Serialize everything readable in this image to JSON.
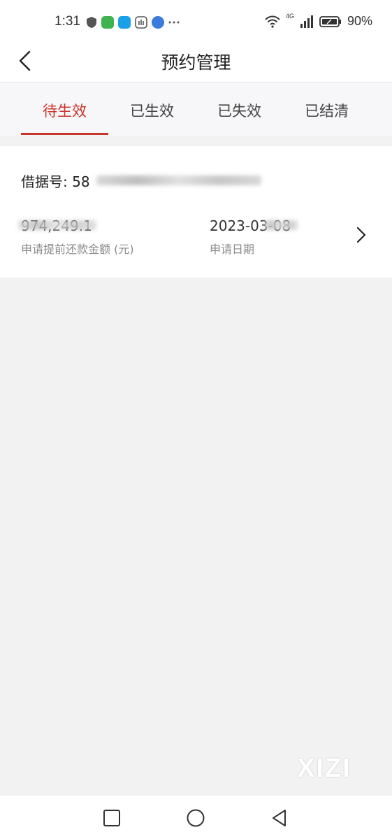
{
  "status_bar": {
    "time": "1:31",
    "network": "4G",
    "battery": "90%"
  },
  "header": {
    "title": "预约管理"
  },
  "tabs": [
    {
      "label": "待生效",
      "active": true
    },
    {
      "label": "已生效",
      "active": false
    },
    {
      "label": "已失效",
      "active": false
    },
    {
      "label": "已结清",
      "active": false
    }
  ],
  "record": {
    "loan_no_label": "借据号:",
    "loan_no_visible": "58",
    "amount_visible": "974,249.1",
    "amount_label": "申请提前还款金额 (元)",
    "date_visible": "2023-03-08",
    "date_label": "申请日期"
  },
  "watermark": "XIZI",
  "colors": {
    "accent": "#c9352b",
    "background": "#f2f2f2"
  }
}
